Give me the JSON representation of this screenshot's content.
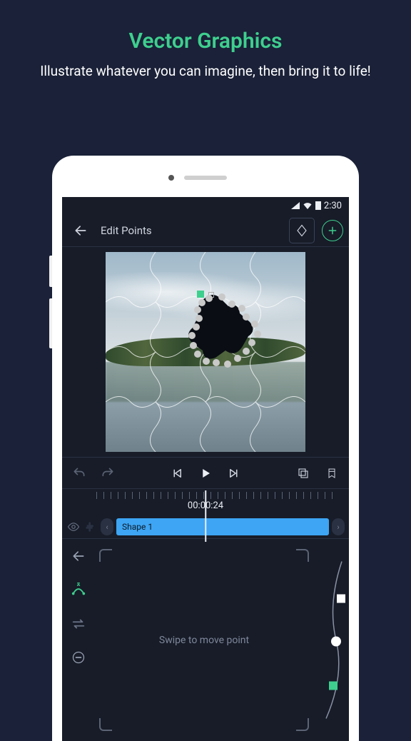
{
  "promo": {
    "title": "Vector Graphics",
    "subtitle": "Illustrate whatever you can imagine, then bring it to life!"
  },
  "status": {
    "time": "2:30"
  },
  "appbar": {
    "title": "Edit Points"
  },
  "timeline": {
    "time": "00:00:24",
    "clip_label": "Shape 1"
  },
  "panel": {
    "hint": "Swipe to move point"
  },
  "icons": {
    "back": "back-arrow",
    "diamond": "diamond",
    "add": "plus",
    "undo": "undo",
    "redo": "redo",
    "skip_start": "skip-start",
    "play": "play",
    "skip_end": "skip-end",
    "layers": "layers",
    "bookmark": "bookmark",
    "eye": "eye",
    "puzzle": "puzzle",
    "prev": "‹",
    "next": "›",
    "tool_back": "back-arrow",
    "tool_curve": "add-curve-point",
    "tool_swap": "swap-direction",
    "tool_remove": "remove-point"
  },
  "colors": {
    "accent": "#3ecf8e",
    "clip": "#3da5f4"
  }
}
